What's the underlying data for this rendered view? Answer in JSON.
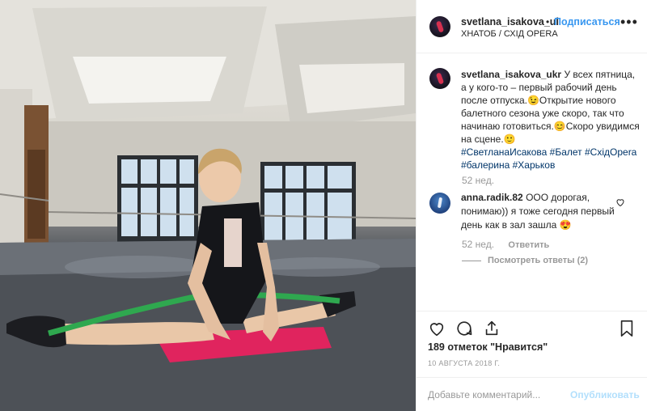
{
  "post": {
    "username": "svetlana_isakova_ul",
    "separator": "•",
    "follow_label": "Подписаться",
    "location": "ХНАТОБ / СХІД OPERA",
    "more_label": "•••"
  },
  "caption": {
    "username": "svetlana_isakova_ukr",
    "text": "У всех пятница, а у кого-то – первый рабочий день после отпуска.😉Открытие нового балетного сезона уже скоро, так что начинаю готовиться.😊Скоро увидимся на сцене.🙂",
    "hashtags": "#СветланаИсакова #Балет #СхідOpera #балерина #Харьков",
    "age": "52 нед."
  },
  "comment": {
    "username": "anna.radik.82",
    "text": "ООО дорогая, понимаю)) я тоже сегодня первый день как в зал зашла 😍",
    "age": "52 нед.",
    "reply_label": "Ответить",
    "view_replies": "Посмотреть ответы (2)"
  },
  "stats": {
    "likes": "189 отметок \"Нравится\"",
    "date": "10 АВГУСТА 2018 Г."
  },
  "comment_box": {
    "placeholder": "Добавьте комментарий...",
    "publish_label": "Опубликовать"
  },
  "colors": {
    "accent": "#3897f0",
    "publish_disabled": "#b2dffc",
    "mat": "#e0245e",
    "band": "#2fa84f"
  },
  "icons": [
    "heart-icon",
    "comment-icon",
    "share-icon",
    "bookmark-icon",
    "more-icon"
  ]
}
